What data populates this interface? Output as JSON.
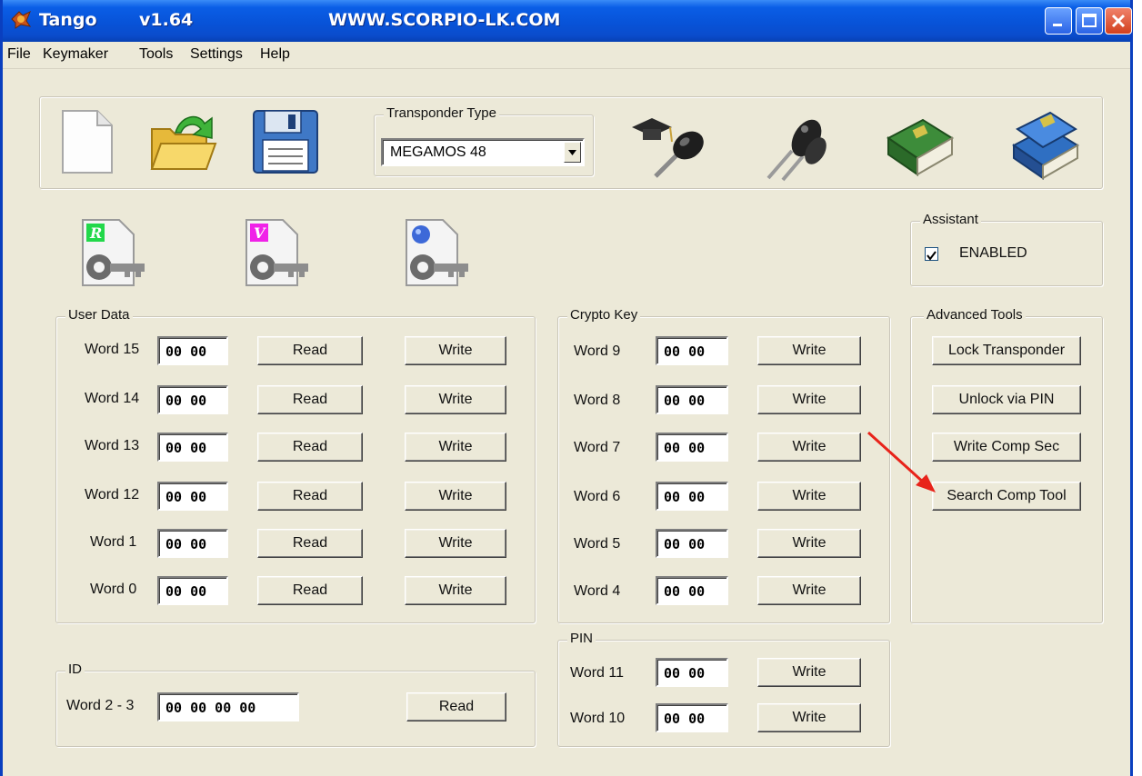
{
  "window": {
    "app_name": "Tango",
    "version": "v1.64",
    "website": "WWW.SCORPIO-LK.COM"
  },
  "menu": [
    "File",
    "Keymaker",
    "Tools",
    "Settings",
    "Help"
  ],
  "toolbar": {
    "icons": [
      "new-file-icon",
      "open-folder-icon",
      "save-disk-icon",
      "key-graduate-icon",
      "keys-icon",
      "book-icon",
      "books-icon"
    ],
    "transponder_label": "Transponder Type",
    "transponder_value": "MEGAMOS 48"
  },
  "file_icons": [
    "r-key-file-icon",
    "v-key-file-icon",
    "globe-key-file-icon"
  ],
  "assistant": {
    "label": "Assistant",
    "checkbox_label": "ENABLED",
    "checked": true
  },
  "user_data": {
    "label": "User Data",
    "rows": [
      {
        "label": "Word 15",
        "value": "00 00"
      },
      {
        "label": "Word 14",
        "value": "00 00"
      },
      {
        "label": "Word 13",
        "value": "00 00"
      },
      {
        "label": "Word 12",
        "value": "00 00"
      },
      {
        "label": "Word 1",
        "value": "00 00"
      },
      {
        "label": "Word 0",
        "value": "00 00"
      }
    ],
    "read_label": "Read",
    "write_label": "Write"
  },
  "crypto_key": {
    "label": "Crypto Key",
    "rows": [
      {
        "label": "Word 9",
        "value": "00 00"
      },
      {
        "label": "Word 8",
        "value": "00 00"
      },
      {
        "label": "Word 7",
        "value": "00 00"
      },
      {
        "label": "Word 6",
        "value": "00 00"
      },
      {
        "label": "Word 5",
        "value": "00 00"
      },
      {
        "label": "Word 4",
        "value": "00 00"
      }
    ],
    "write_label": "Write"
  },
  "pin": {
    "label": "PIN",
    "rows": [
      {
        "label": "Word 11",
        "value": "00 00"
      },
      {
        "label": "Word 10",
        "value": "00 00"
      }
    ],
    "write_label": "Write"
  },
  "id": {
    "label": "ID",
    "row_label": "Word 2 - 3",
    "value": "00 00 00 00",
    "read_label": "Read"
  },
  "advanced_tools": {
    "label": "Advanced Tools",
    "buttons": [
      "Lock Transponder",
      "Unlock via PIN",
      "Write Comp Sec",
      "Search Comp Tool"
    ]
  },
  "colors": {
    "title_bar": "#0a5ee6",
    "window_bg": "#ece9d8",
    "annotation_arrow": "#e8231a"
  }
}
